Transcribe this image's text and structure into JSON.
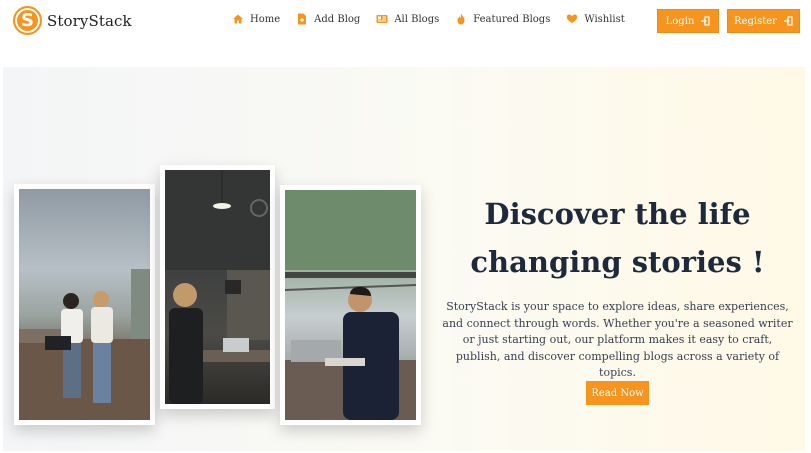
{
  "brand": {
    "logo_letter": "S",
    "name": "StoryStack",
    "accent": "#f7941d"
  },
  "nav": {
    "items": [
      {
        "label": "Home",
        "icon": "home-icon"
      },
      {
        "label": "Add Blog",
        "icon": "document-add-icon"
      },
      {
        "label": "All Blogs",
        "icon": "blogs-list-icon"
      },
      {
        "label": "Featured Blogs",
        "icon": "flame-icon"
      },
      {
        "label": "Wishlist",
        "icon": "heart-hand-icon"
      }
    ],
    "login_label": "Login",
    "register_label": "Register"
  },
  "hero": {
    "title_line1": "Discover the life",
    "title_line2": "changing stories !",
    "description": "StoryStack is your space to explore ideas, share experiences, and connect through words. Whether you're a seasoned writer or just starting out, our platform makes it easy to craft, publish, and discover compelling blogs across a variety of topics.",
    "cta_label": "Read Now",
    "photos": [
      "photo-friends-with-laptop",
      "photo-woman-at-laptop-cafe",
      "photo-man-typing-on-balcony"
    ]
  }
}
